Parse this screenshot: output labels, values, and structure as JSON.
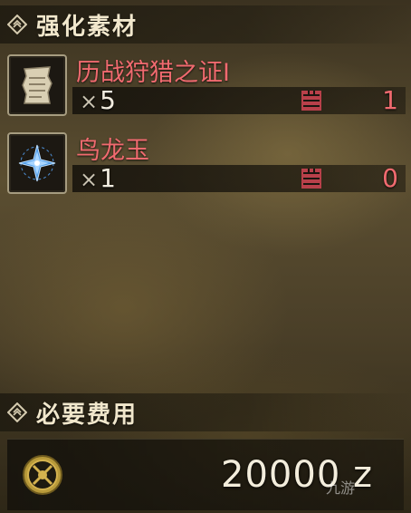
{
  "materials_section": {
    "title": "强化素材",
    "icon": "diamond-emblem-icon"
  },
  "materials": [
    {
      "name": "历战狩猎之证Ⅰ",
      "icon": "scroll-parchment-icon",
      "qty_prefix": "×",
      "required": "5",
      "storage_icon": "storage-box-icon",
      "owned": "1",
      "name_color": "#f06a6f"
    },
    {
      "name": "鸟龙玉",
      "icon": "blue-star-gem-icon",
      "qty_prefix": "×",
      "required": "1",
      "storage_icon": "storage-box-icon",
      "owned": "0",
      "name_color": "#f06a6f"
    }
  ],
  "cost_section": {
    "title": "必要费用",
    "icon": "diamond-emblem-icon"
  },
  "cost": {
    "icon": "zenny-coin-icon",
    "value": "20000 z",
    "watermark": "九游"
  }
}
